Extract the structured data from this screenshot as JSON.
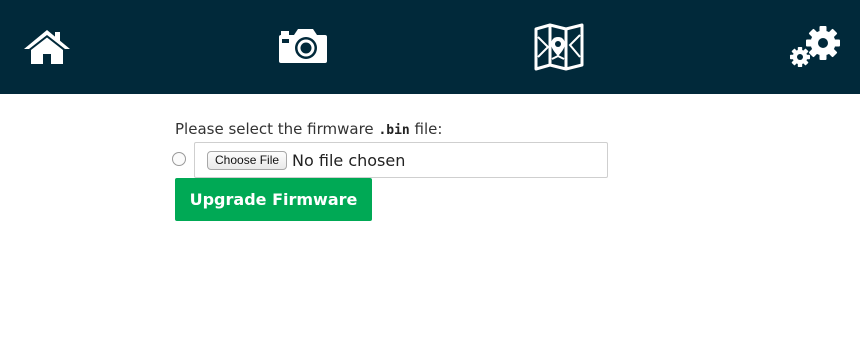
{
  "nav": {
    "items": [
      {
        "icon": "home-icon"
      },
      {
        "icon": "camera-icon"
      },
      {
        "icon": "map-icon"
      },
      {
        "icon": "gear-icon"
      }
    ],
    "background": "#01293a"
  },
  "firmware": {
    "prompt_before": "Please select the firmware ",
    "prompt_code": ".bin",
    "prompt_after": " file:",
    "choose_file_label": "Choose File",
    "file_status": "No file chosen",
    "upgrade_label": "Upgrade Firmware",
    "accent_color": "#00a955"
  }
}
